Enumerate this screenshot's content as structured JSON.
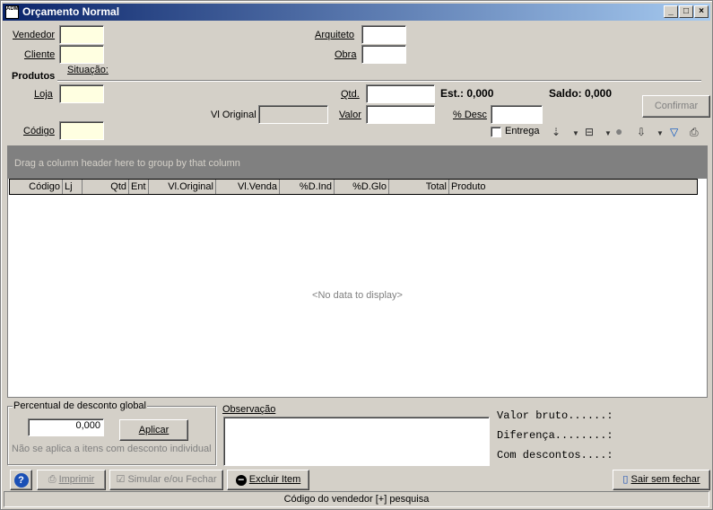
{
  "window": {
    "title": "Orçamento Normal",
    "app_icon_text": "ADM",
    "controls": [
      "_",
      "□",
      "×"
    ]
  },
  "header": {
    "vendedor_label": "Vendedor",
    "vendedor_value": "",
    "cliente_label": "Cliente",
    "cliente_value": "",
    "arquiteto_label": "Arquiteto",
    "arquiteto_value": "",
    "obra_label": "Obra",
    "obra_value": ""
  },
  "produtos": {
    "section_label": "Produtos",
    "situacao_label": "Situação:",
    "loja_label": "Loja",
    "loja_value": "",
    "codigo_label": "Código",
    "codigo_value": "",
    "vl_original_label": "Vl Original",
    "vl_original_value": "",
    "qtd_label": "Qtd.",
    "qtd_value": "",
    "valor_label": "Valor",
    "valor_value": "",
    "est_label": "Est.: 0,000",
    "saldo_label": "Saldo: 0,000",
    "desc_label": "% Desc",
    "desc_value": "",
    "entrega_label": "Entrega",
    "confirmar_label": "Confirmar"
  },
  "grid": {
    "group_hint": "Drag a column header here to group by that column",
    "columns": [
      "Código",
      "Lj",
      "Qtd",
      "Ent",
      "Vl.Original",
      "Vl.Venda",
      "%D.Ind",
      "%D.Glo",
      "Total",
      "Produto"
    ],
    "empty_text": "<No data to display>"
  },
  "desconto": {
    "group_label": "Percentual de desconto global",
    "value": "0,000",
    "apply_label": "Aplicar",
    "note": "Não se aplica a itens com desconto individual"
  },
  "observacao": {
    "label": "Observação",
    "value": ""
  },
  "totals": {
    "valor_bruto": "Valor bruto......:",
    "diferenca": "Diferença........:",
    "com_descontos": "Com descontos....:"
  },
  "footer": {
    "help_label": "?",
    "imprimir_label": "Imprimir",
    "simular_label": "Simular e/ou Fechar",
    "excluir_label": "Excluir Item",
    "sair_label": "Sair sem fechar"
  },
  "status": {
    "text": "Código do vendedor [+] pesquisa"
  }
}
